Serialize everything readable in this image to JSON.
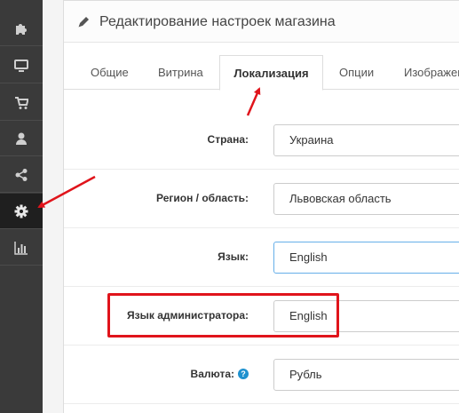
{
  "sidebar": {
    "items": [
      {
        "icon": "puzzle-icon",
        "active": false
      },
      {
        "icon": "monitor-icon",
        "active": false
      },
      {
        "icon": "cart-icon",
        "active": false
      },
      {
        "icon": "user-icon",
        "active": false
      },
      {
        "icon": "share-icon",
        "active": false
      },
      {
        "icon": "gear-icon",
        "active": true
      },
      {
        "icon": "bar-chart-icon",
        "active": false
      }
    ]
  },
  "header": {
    "title": "Редактирование настроек магазина"
  },
  "tabs": [
    "Общие",
    "Витрина",
    "Локализация",
    "Опции",
    "Изображения"
  ],
  "form": {
    "country_label": "Страна:",
    "country_value": "Украина",
    "region_label": "Регион / область:",
    "region_value": "Львовская область",
    "language_label": "Язык:",
    "language_value": "English",
    "admin_language_label": "Язык администратора:",
    "admin_language_value": "English",
    "currency_label": "Валюта:",
    "currency_value": "Рубль",
    "currency_help": "?"
  },
  "colors": {
    "annotation": "#e0141b",
    "sidebar_bg": "#3a3a3a",
    "help_icon": "#1e91cf"
  }
}
